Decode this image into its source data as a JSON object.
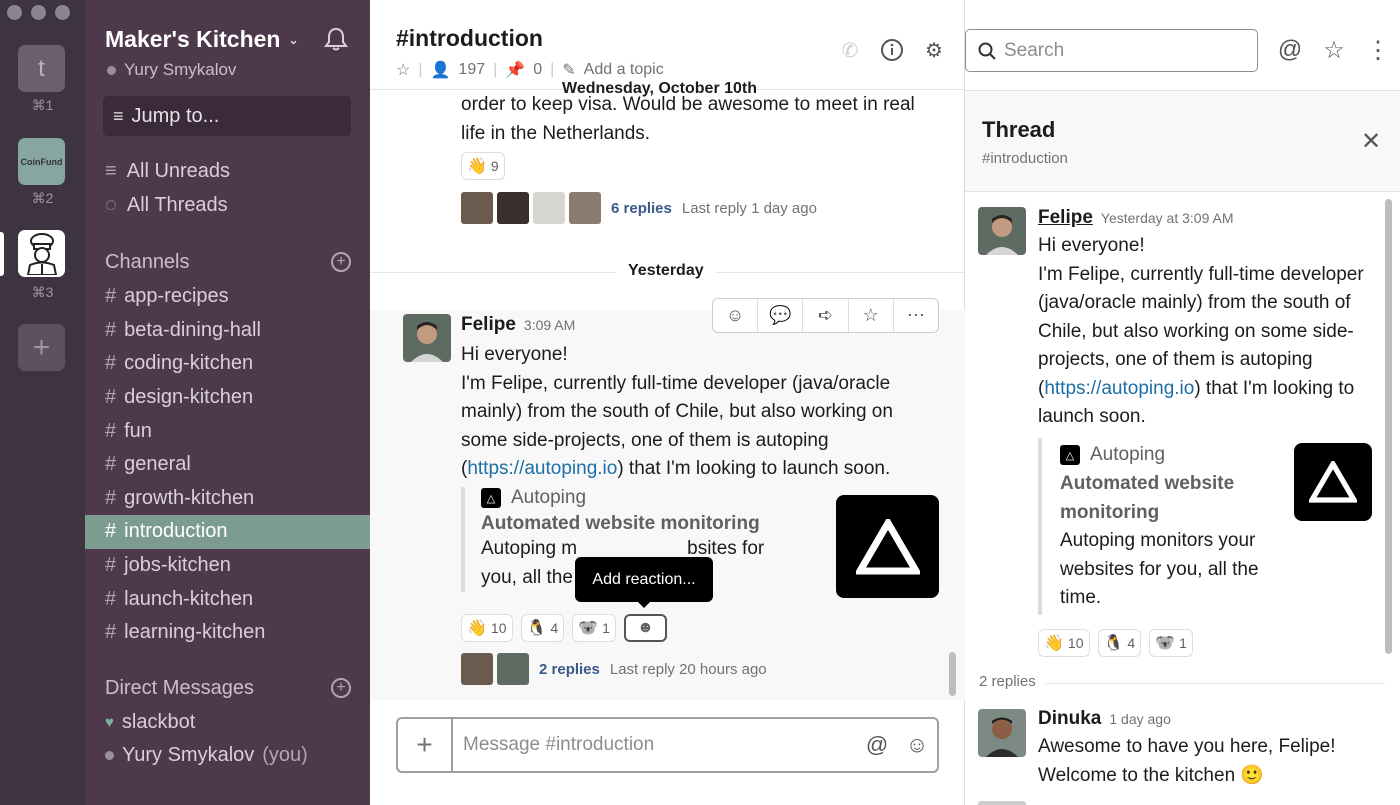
{
  "rail": {
    "workspaces": [
      {
        "letter": "t",
        "shortcut": "⌘1"
      },
      {
        "letter": "CoinFund",
        "shortcut": "⌘2"
      },
      {
        "letter": "",
        "shortcut": "⌘3"
      }
    ],
    "add": "+"
  },
  "sidebar": {
    "team_name": "Maker's Kitchen",
    "user": "Yury Smykalov",
    "jump_to": "Jump to...",
    "all_unreads": "All Unreads",
    "all_threads": "All Threads",
    "channels_label": "Channels",
    "channels": [
      "app-recipes",
      "beta-dining-hall",
      "coding-kitchen",
      "design-kitchen",
      "fun",
      "general",
      "growth-kitchen",
      "introduction",
      "jobs-kitchen",
      "launch-kitchen",
      "learning-kitchen"
    ],
    "active_channel": "introduction",
    "dm_label": "Direct Messages",
    "dms": [
      {
        "name": "slackbot",
        "suffix": ""
      },
      {
        "name": "Yury Smykalov",
        "suffix": "(you)"
      }
    ]
  },
  "header": {
    "channel": "#introduction",
    "members": "197",
    "pins": "0",
    "add_topic": "Add a topic",
    "search_placeholder": "Search"
  },
  "main": {
    "date_pill": "Wednesday, October 10th",
    "prev_message": {
      "line1": "order to keep visa. Would be awesome to meet in real",
      "line2": "life in the Netherlands.",
      "reaction": {
        "emoji": "👋",
        "count": "9"
      },
      "replies": "6 replies",
      "last_reply": "Last reply 1 day ago"
    },
    "day_divider": "Yesterday",
    "message": {
      "author": "Felipe",
      "time": "3:09 AM",
      "line1": "Hi everyone!",
      "line2": "I'm Felipe, currently full-time developer (java/oracle",
      "line3": "mainly) from the south of Chile, but also working on",
      "line4": "some side-projects, one of them is autoping",
      "line5_pre": "(",
      "link": "https://autoping.io",
      "line5_post": ") that I'm looking to launch soon.",
      "attachment": {
        "site": "Autoping",
        "title": "Automated website monitoring",
        "desc1": "Autoping m",
        "desc1b": "bsites for",
        "desc2": "you, all the"
      },
      "reactions": [
        {
          "emoji": "👋",
          "count": "10"
        },
        {
          "emoji": "🐧",
          "count": "4"
        },
        {
          "emoji": "🐨",
          "count": "1"
        }
      ],
      "replies": "2 replies",
      "last_reply": "Last reply 20 hours ago"
    },
    "tooltip": "Add reaction...",
    "composer_placeholder": "Message #introduction"
  },
  "thread": {
    "title": "Thread",
    "channel": "#introduction",
    "message": {
      "author": "Felipe",
      "time": "Yesterday at 3:09 AM",
      "lines": [
        "Hi everyone!",
        "I'm Felipe, currently full-time developer",
        "(java/oracle mainly) from the south of",
        "Chile, but also working on some side-",
        "projects, one of them is autoping"
      ],
      "link_pre": "(",
      "link": "https://autoping.io",
      "link_post": ") that I'm looking to",
      "last_line": "launch soon.",
      "attachment": {
        "site": "Autoping",
        "title1": "Automated website",
        "title2": "monitoring",
        "desc": [
          "Autoping monitors your",
          "websites for you, all the",
          "time."
        ]
      },
      "reactions": [
        {
          "emoji": "👋",
          "count": "10"
        },
        {
          "emoji": "🐧",
          "count": "4"
        },
        {
          "emoji": "🐨",
          "count": "1"
        }
      ]
    },
    "replies_label": "2 replies",
    "reply": {
      "author": "Dinuka",
      "time": "1 day ago",
      "line1": "Awesome to have you here, Felipe!",
      "line2": "Welcome to the kitchen",
      "emoji": "🙂"
    }
  },
  "colors": {
    "sidebar": "#4d394b",
    "rail": "#3e3340",
    "active_channel": "#7b9c8f",
    "link": "#1d6fa5"
  }
}
